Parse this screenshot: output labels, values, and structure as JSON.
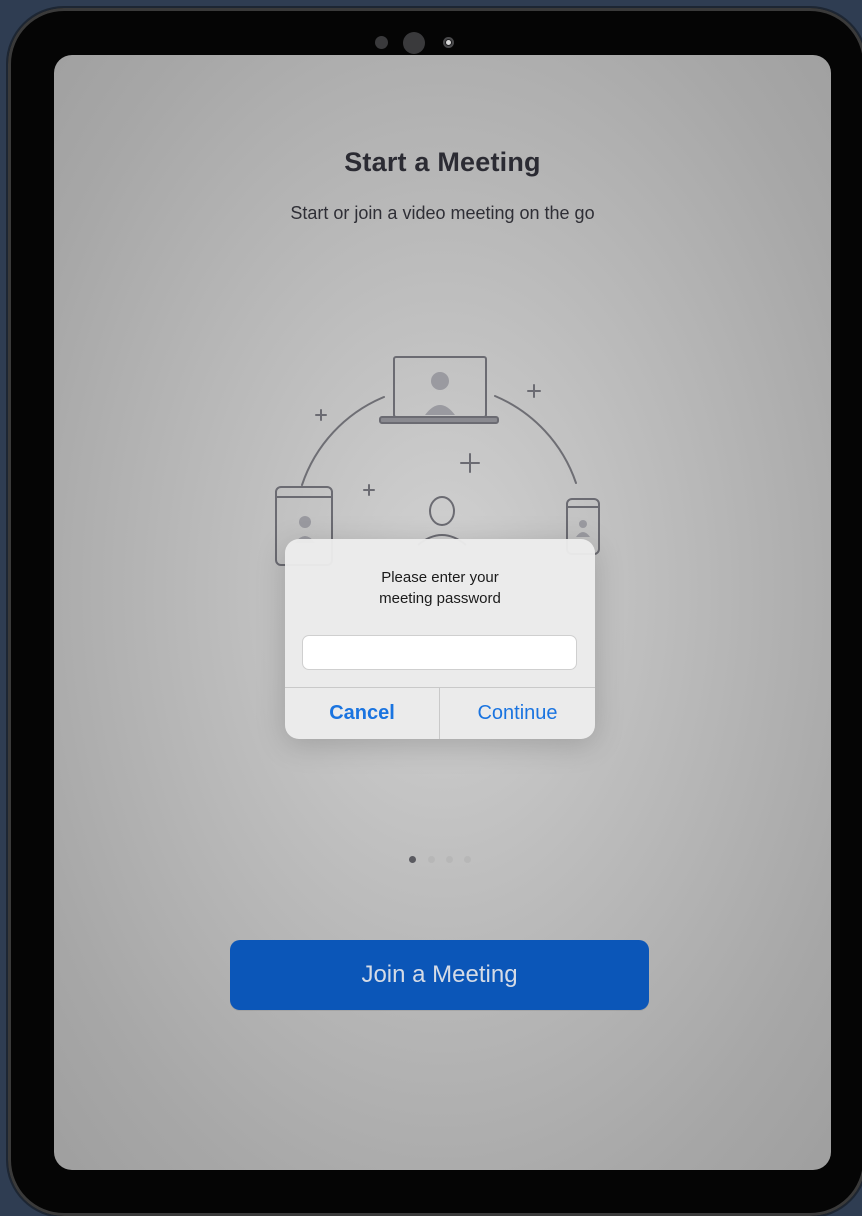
{
  "onboarding": {
    "title": "Start a Meeting",
    "subtitle": "Start or join a video meeting on the go",
    "page_indicator": {
      "total": 4,
      "current": 1
    },
    "join_button_label": "Join a Meeting"
  },
  "dialog": {
    "message_line1": "Please enter your",
    "message_line2": "meeting password",
    "password_value": "",
    "cancel_label": "Cancel",
    "continue_label": "Continue"
  },
  "colors": {
    "accent": "#1a74e0",
    "join_button": "#0b56b8",
    "device_frame": "#050505",
    "background": "#2f3d52"
  },
  "icons": [
    "laptop-icon",
    "tablet-icon",
    "phone-icon",
    "person-icon",
    "plus-icon"
  ]
}
